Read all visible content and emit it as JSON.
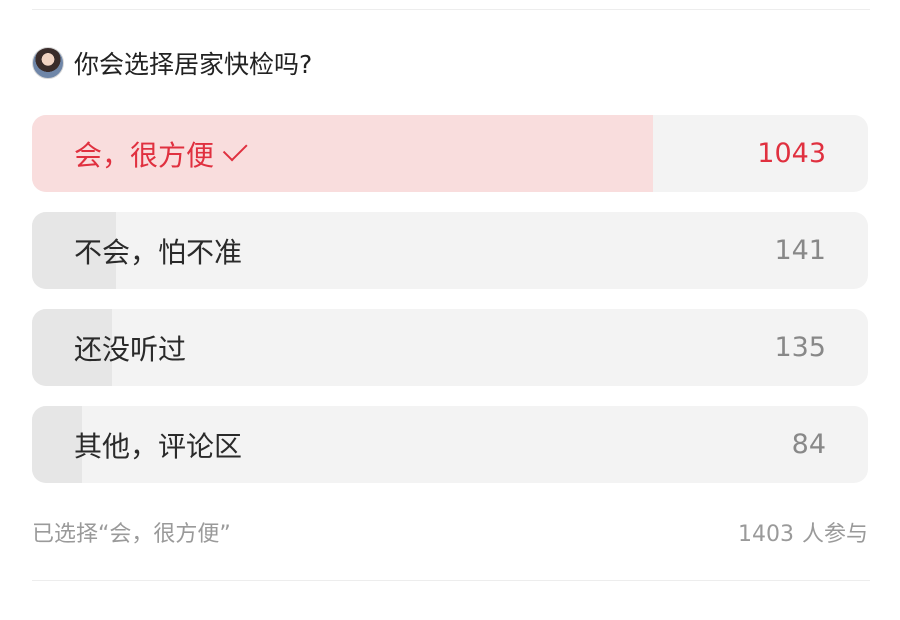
{
  "poll": {
    "question": "你会选择居家快检吗?",
    "selected_text": "已选择“会，很方便”",
    "participants_count": "1403",
    "participants_suffix": "人参与"
  },
  "colors": {
    "selected_text": "#e0303f",
    "selected_fill": "#f9dddd",
    "bar_fill": "#e6e6e6",
    "track": "#f3f3f3"
  },
  "chart_data": {
    "type": "bar",
    "orientation": "horizontal",
    "categories": [
      "会，很方便",
      "不会，怕不准",
      "还没听过",
      "其他，评论区"
    ],
    "values": [
      1043,
      141,
      135,
      84
    ],
    "total": 1403,
    "selected_index": 0,
    "title": "你会选择居家快检吗?"
  }
}
